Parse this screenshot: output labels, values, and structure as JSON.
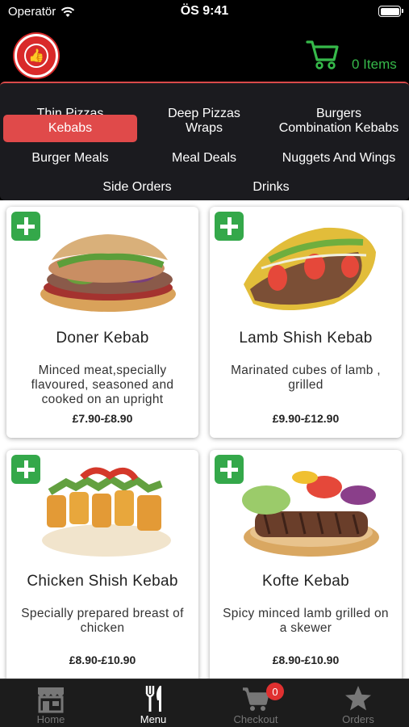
{
  "status": {
    "carrier": "Operatör",
    "time": "ÖS 9:41"
  },
  "header": {
    "cart_count_label": "0 Items"
  },
  "categories": [
    {
      "label": "Thin Pizzas"
    },
    {
      "label": "Deep Pizzas"
    },
    {
      "label": "Burgers"
    },
    {
      "label": "Kebabs",
      "active": true
    },
    {
      "label": "Wraps"
    },
    {
      "label": "Combination Kebabs"
    },
    {
      "label": "Burger Meals"
    },
    {
      "label": "Meal Deals"
    },
    {
      "label": "Nuggets And Wings"
    },
    {
      "label": "Side Orders"
    },
    {
      "label": "Drinks"
    }
  ],
  "products": [
    {
      "name": "Doner Kebab",
      "description": "Minced meat,specially flavoured, seasoned and cooked on an upright",
      "price": "£7.90-£8.90"
    },
    {
      "name": "Lamb Shish Kebab",
      "description": "Marinated cubes of lamb , grilled",
      "price": "£9.90-£12.90"
    },
    {
      "name": "Chicken Shish Kebab",
      "description": "Specially prepared breast of chicken",
      "price": "£8.90-£10.90"
    },
    {
      "name": "Kofte Kebab",
      "description": "Spicy minced lamb grilled on a skewer",
      "price": "£8.90-£10.90"
    }
  ],
  "tabs": [
    {
      "label": "Home",
      "icon": "store-icon"
    },
    {
      "label": "Menu",
      "icon": "cutlery-icon",
      "active": true
    },
    {
      "label": "Checkout",
      "icon": "cart-icon",
      "badge": "0"
    },
    {
      "label": "Orders",
      "icon": "star-icon"
    }
  ],
  "colors": {
    "accent_green": "#36b94a",
    "active_category": "#e04a4a",
    "badge_red": "#e03030"
  }
}
